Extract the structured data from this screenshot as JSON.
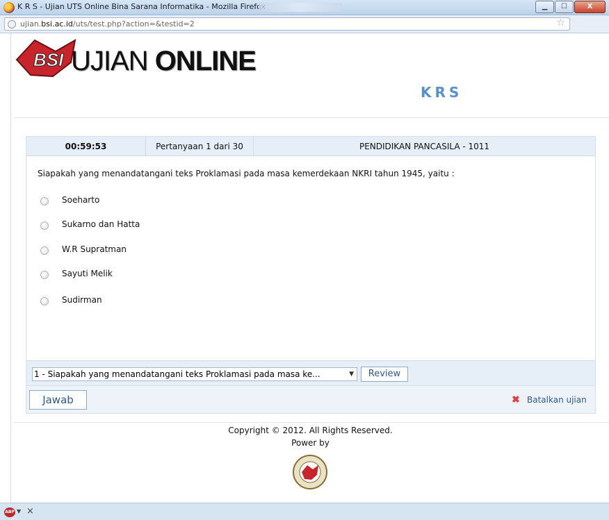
{
  "window": {
    "title": "K R S - Ujian UTS Online Bina Sarana Informatika - Mozilla Firefox",
    "min_glyph": "▁",
    "max_glyph": "☐",
    "close_glyph": "X"
  },
  "browser": {
    "url_prefix": "ujian.",
    "url_domain": "bsi.ac.id",
    "url_path": "/uts/test.php?action=&testid=2"
  },
  "header": {
    "logo_thin": "UJIAN ",
    "logo_bold": "ONLINE",
    "section": "KRS"
  },
  "exam": {
    "timer": "00:59:53",
    "counter": "Pertanyaan 1 dari 30",
    "subject": "PENDIDIKAN PANCASILA - 1011",
    "question": "Siapakah yang menandatangani teks Proklamasi pada masa kemerdekaan NKRI tahun 1945, yaitu :",
    "options": [
      {
        "label": "Soeharto"
      },
      {
        "label": "Sukarno dan Hatta"
      },
      {
        "label": "W.R Supratman"
      },
      {
        "label": "Sayuti Melik"
      },
      {
        "label": "Sudirman"
      }
    ],
    "question_select": "1 - Siapakah yang menandatangani teks Proklamasi pada masa ke...",
    "review_label": "Review",
    "answer_label": "Jawab",
    "cancel_label": "Batalkan ujian"
  },
  "footer": {
    "copyright": "Copyright © 2012. All Rights Reserved.",
    "powered_by": "Power by"
  },
  "statusbar": {
    "abp_label": "ABP",
    "close_glyph": "×"
  },
  "colors": {
    "accent": "#5a8fcf",
    "link": "#2e5a8f",
    "panel": "#e6eef8"
  }
}
